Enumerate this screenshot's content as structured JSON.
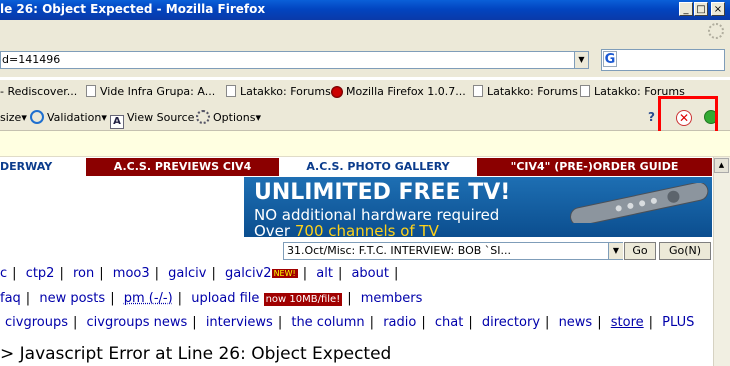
{
  "window": {
    "title": "le 26: Object Expected - Mozilla Firefox",
    "min": "_",
    "max": "□",
    "close": "×"
  },
  "nav": {
    "url": "d=141496",
    "url_drop": "▼",
    "search_logo": "G"
  },
  "bookmarks": [
    {
      "label": "- Rediscover..."
    },
    {
      "label": "Vide Infra Grupa: A..."
    },
    {
      "label": "Latakko: Forums"
    },
    {
      "label": "Mozilla Firefox 1.0.7..."
    },
    {
      "label": "Latakko: Forums"
    },
    {
      "label": "Latakko: Forums"
    }
  ],
  "devbar": {
    "resize": "size▾",
    "validation": "Validation▾",
    "view_source": "View Source",
    "options": "Options▾"
  },
  "page": {
    "navstrip": [
      {
        "label": "DERWAY",
        "bg": "#ffffff",
        "fg": "#0b3c8c"
      },
      {
        "label": "A.C.S. PREVIEWS CIV4",
        "bg": "#8b0000",
        "fg": "#ffffff"
      },
      {
        "label": "A.C.S. PHOTO GALLERY",
        "bg": "#ffffff",
        "fg": "#0b3c8c"
      },
      {
        "label": "\"CIV4\" (PRE-)ORDER GUIDE",
        "bg": "#8b0000",
        "fg": "#ffffff"
      }
    ],
    "banner": {
      "title": "UNLIMITED FREE TV!",
      "sub": "NO additional hardware required",
      "sub2_prefix": "Over ",
      "sub2_highlight": "700 channels of TV"
    },
    "news_select": "31.Oct/Misc: F.T.C. INTERVIEW: BOB `SI...",
    "go": "Go",
    "go_n": "Go(N)",
    "row1": [
      "c",
      "ctp2",
      "ron",
      "moo3",
      "galciv",
      "galciv2",
      "alt",
      "about"
    ],
    "row1_new_badge": "NEW!",
    "row2": [
      "faq",
      "new posts",
      "pm (-/-)",
      "upload file",
      "members"
    ],
    "row2_upload_badge": "now 10MB/file!",
    "row3": [
      "civgroups",
      "civgroups news",
      "interviews",
      "the column",
      "radio",
      "chat",
      "directory",
      "news",
      "store",
      "PLUS"
    ],
    "error_title": "> Javascript Error at Line 26: Object Expected"
  },
  "colors": {
    "highlight_box": "#ff0000",
    "accent_red": "#8b0000",
    "link_blue": "#0000aa"
  }
}
